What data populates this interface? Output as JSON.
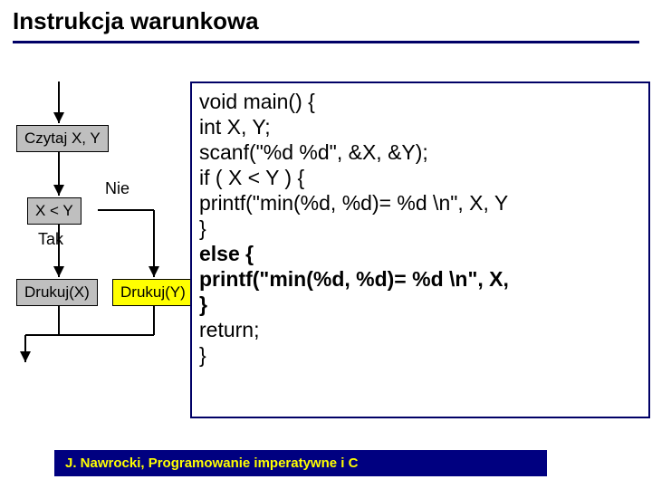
{
  "title": "Instrukcja warunkowa",
  "flow": {
    "read": "Czytaj X, Y",
    "cond": "X < Y",
    "no": "Nie",
    "yes": "Tak",
    "left": "Drukuj(X)",
    "right": "Drukuj(Y)"
  },
  "code": {
    "l1": "void main() {",
    "l2": "        int   X, Y;",
    "l3": "        scanf(\"%d %d\", &X, &Y);",
    "l4": "        if ( X < Y ) {",
    "l5": "           printf(\"min(%d, %d)= %d \\n\", X, Y",
    "l6": "           }",
    "l7": "        else {",
    "l8": "           printf(\"min(%d, %d)= %d \\n\", X,",
    "l9": "           }",
    "l10": "        return;",
    "l11": "        }"
  },
  "footer": "J. Nawrocki, Programowanie imperatywne i C"
}
